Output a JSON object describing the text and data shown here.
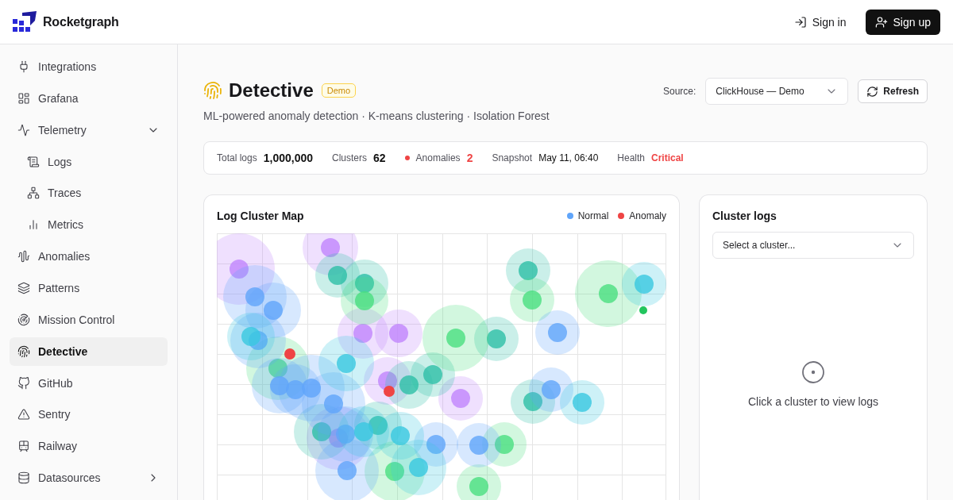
{
  "brand": {
    "name": "Rocketgraph"
  },
  "header": {
    "buttons": [
      {
        "label": "Sign in",
        "kind": "ghost"
      },
      {
        "label": "Sign up",
        "kind": "primary"
      }
    ]
  },
  "sidebar": {
    "items": [
      {
        "label": "Integrations",
        "selected": false
      },
      {
        "label": "Grafana",
        "selected": false
      },
      {
        "label": "Telemetry",
        "selected": false,
        "expanded": true,
        "children": [
          {
            "label": "Logs",
            "selected": false
          },
          {
            "label": "Traces",
            "selected": false
          },
          {
            "label": "Metrics",
            "selected": false
          }
        ]
      },
      {
        "label": "Anomalies",
        "selected": false
      },
      {
        "label": "Patterns",
        "selected": false
      },
      {
        "label": "Mission Control",
        "selected": false
      },
      {
        "label": "Detective",
        "selected": true
      },
      {
        "label": "GitHub",
        "selected": false
      },
      {
        "label": "Sentry",
        "selected": false
      },
      {
        "label": "Railway",
        "selected": false
      },
      {
        "label": "Datasources",
        "selected": false,
        "expanded": false
      }
    ]
  },
  "page": {
    "title": "Detective",
    "badge": "Demo",
    "subtitle": "ML-powered anomaly detection · K-means clustering · Isolation Forest",
    "source_label": "Source:",
    "source_value": "ClickHouse — Demo",
    "refresh": "Refresh"
  },
  "stats": [
    {
      "label": "Total logs",
      "value": "1,000,000",
      "kind": "count"
    },
    {
      "label": "Clusters",
      "value": "62",
      "kind": "count"
    },
    {
      "label": "Anomalies",
      "value": "2",
      "kind": "alert-count"
    },
    {
      "label": "Snapshot",
      "value": "May 11, 06:40",
      "kind": "text"
    },
    {
      "label": "Health",
      "value": "Critical",
      "kind": "status"
    }
  ],
  "cluster_map": {
    "title": "Log Cluster Map",
    "legend": [
      {
        "label": "Normal",
        "color": "#60a5fa"
      },
      {
        "label": "Anomaly",
        "color": "#ef4444"
      }
    ]
  },
  "cluster_logs": {
    "title": "Cluster logs",
    "placeholder": "Select a cluster...",
    "empty_text": "Click a cluster to view logs"
  }
}
